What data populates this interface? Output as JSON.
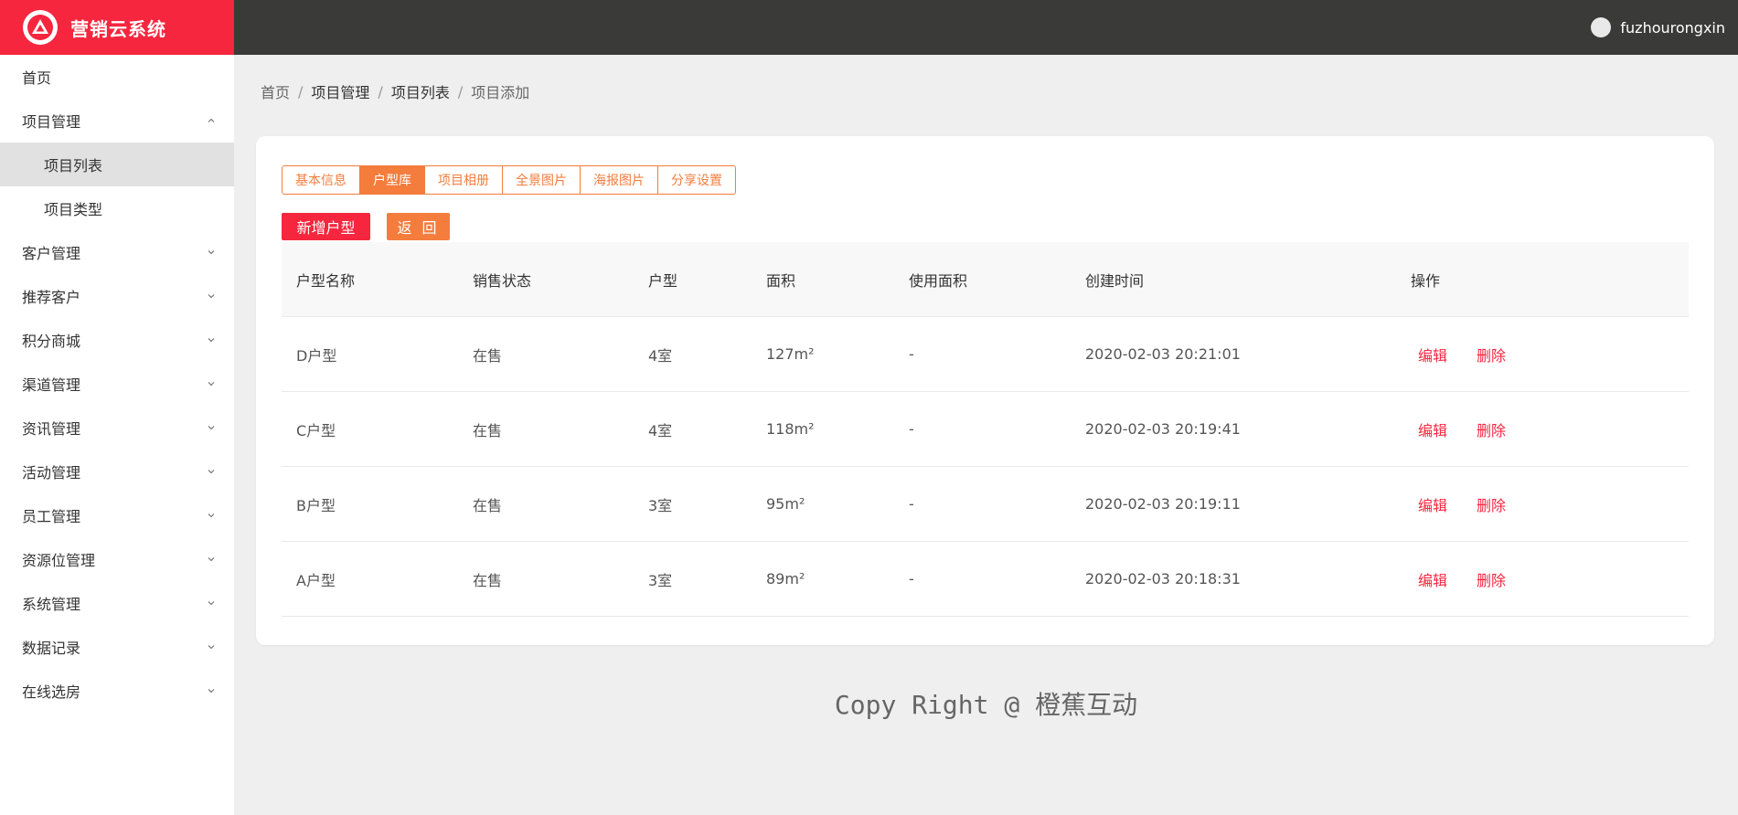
{
  "app": {
    "name": "营销云系统",
    "user": "fuzhourongxin"
  },
  "sidebar": {
    "items": [
      {
        "label": "首页",
        "type": "link"
      },
      {
        "label": "项目管理",
        "type": "group",
        "expanded": true
      },
      {
        "label": "项目列表",
        "type": "sub",
        "active": true
      },
      {
        "label": "项目类型",
        "type": "sub"
      },
      {
        "label": "客户管理",
        "type": "group"
      },
      {
        "label": "推荐客户",
        "type": "group"
      },
      {
        "label": "积分商城",
        "type": "group"
      },
      {
        "label": "渠道管理",
        "type": "group"
      },
      {
        "label": "资讯管理",
        "type": "group"
      },
      {
        "label": "活动管理",
        "type": "group"
      },
      {
        "label": "员工管理",
        "type": "group"
      },
      {
        "label": "资源位管理",
        "type": "group"
      },
      {
        "label": "系统管理",
        "type": "group"
      },
      {
        "label": "数据记录",
        "type": "group"
      },
      {
        "label": "在线选房",
        "type": "group"
      }
    ]
  },
  "breadcrumb": [
    "首页",
    "项目管理",
    "项目列表",
    "项目添加"
  ],
  "tabs": [
    {
      "label": "基本信息"
    },
    {
      "label": "户型库",
      "active": true
    },
    {
      "label": "项目相册"
    },
    {
      "label": "全景图片"
    },
    {
      "label": "海报图片"
    },
    {
      "label": "分享设置"
    }
  ],
  "actions": {
    "add_label": "新增户型",
    "back_label": "返 回"
  },
  "table": {
    "headers": [
      "户型名称",
      "销售状态",
      "户型",
      "面积",
      "使用面积",
      "创建时间",
      "操作"
    ],
    "rows": [
      {
        "name": "D户型",
        "status": "在售",
        "layout": "4室",
        "area": "127m²",
        "usable": "-",
        "created": "2020-02-03 20:21:01"
      },
      {
        "name": "C户型",
        "status": "在售",
        "layout": "4室",
        "area": "118m²",
        "usable": "-",
        "created": "2020-02-03 20:19:41"
      },
      {
        "name": "B户型",
        "status": "在售",
        "layout": "3室",
        "area": "95m²",
        "usable": "-",
        "created": "2020-02-03 20:19:11"
      },
      {
        "name": "A户型",
        "status": "在售",
        "layout": "3室",
        "area": "89m²",
        "usable": "-",
        "created": "2020-02-03 20:18:31"
      }
    ],
    "edit_label": "编辑",
    "delete_label": "删除"
  },
  "footer": {
    "text": "Copy Right @ 橙蕉互动"
  },
  "colors": {
    "brand": "#f5263e",
    "accent": "#f47c3c",
    "header": "#3a3b39",
    "background": "#efefef"
  }
}
